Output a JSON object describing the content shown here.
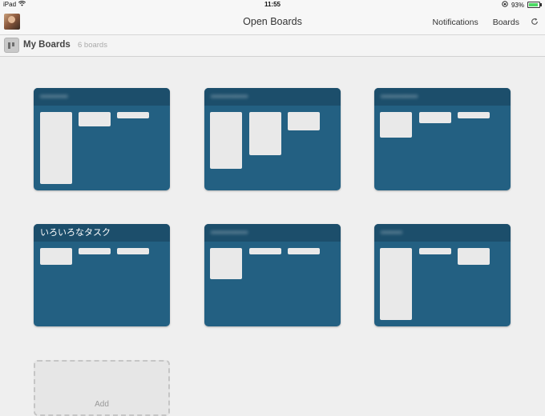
{
  "statusbar": {
    "device": "iPad",
    "time": "11:55",
    "battery": "93%",
    "battery_level": 0.93
  },
  "navbar": {
    "title": "Open Boards",
    "notifications": "Notifications",
    "boards": "Boards"
  },
  "subheader": {
    "title": "My Boards",
    "count": "6 boards"
  },
  "boards": [
    {
      "title": "•••••••••",
      "blurred": true
    },
    {
      "title": "••••••••••••",
      "blurred": true
    },
    {
      "title": "••••••••••••",
      "blurred": true
    },
    {
      "title": "いろいろなタスク",
      "blurred": false
    },
    {
      "title": "••••••••••••",
      "blurred": true
    },
    {
      "title": "•••••••",
      "blurred": true
    }
  ],
  "add_board": {
    "label": "Add"
  },
  "colors": {
    "board_bg": "#236082",
    "board_header": "#1c4e6b",
    "list_bg": "#e9e9e9",
    "page_bg": "#efefef"
  },
  "icons": {
    "wifi": "wifi-icon",
    "rotation_lock": "rotation-lock-icon",
    "battery": "battery-icon",
    "refresh": "refresh-icon",
    "boards": "boards-icon"
  }
}
